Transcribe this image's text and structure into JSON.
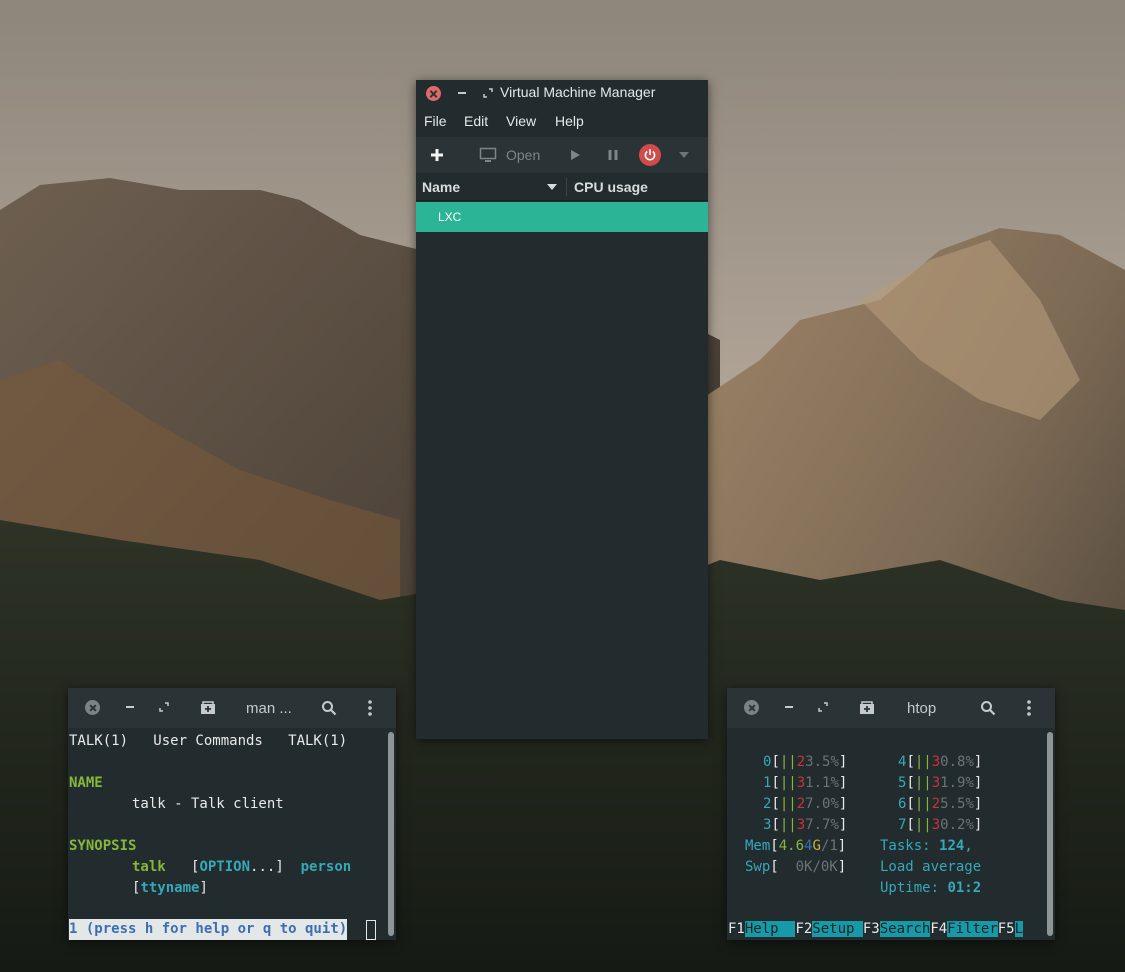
{
  "vmm": {
    "title": "Virtual Machine Manager",
    "menu": [
      "File",
      "Edit",
      "View",
      "Help"
    ],
    "toolbar": {
      "open_label": "Open"
    },
    "columns": {
      "name": "Name",
      "cpu": "CPU usage"
    },
    "rows": [
      {
        "name": "LXC"
      }
    ],
    "colors": {
      "selection": "#2bb496",
      "power": "#d14b4b"
    }
  },
  "man_term": {
    "title": "man ...",
    "lines": {
      "header": "TALK(1)   User Commands   TALK(1)",
      "name_heading": "NAME",
      "name_desc": "talk - Talk client",
      "synopsis_heading": "SYNOPSIS",
      "syn_cmd": "talk",
      "syn_lb": "[",
      "syn_option": "OPTION",
      "syn_rb": "...]",
      "syn_person": "person",
      "syn2_lb": "[",
      "syn2_ttyname": "ttyname",
      "syn2_rb": "]",
      "status": "1 (press h for help or q to quit)"
    }
  },
  "htop_term": {
    "title": "htop",
    "cpus_left": [
      {
        "id": "0",
        "bars": "||",
        "pct_a": "2",
        "pct_b": "3.5%"
      },
      {
        "id": "1",
        "bars": "||",
        "pct_a": "3",
        "pct_b": "1.1%"
      },
      {
        "id": "2",
        "bars": "||",
        "pct_a": "2",
        "pct_b": "7.0%"
      },
      {
        "id": "3",
        "bars": "||",
        "pct_a": "3",
        "pct_b": "7.7%"
      }
    ],
    "cpus_right": [
      {
        "id": "4",
        "bars": "||",
        "pct_a": "3",
        "pct_b": "0.8%"
      },
      {
        "id": "5",
        "bars": "||",
        "pct_a": "3",
        "pct_b": "1.9%"
      },
      {
        "id": "6",
        "bars": "||",
        "pct_a": "2",
        "pct_b": "5.5%"
      },
      {
        "id": "7",
        "bars": "||",
        "pct_a": "3",
        "pct_b": "0.2%"
      }
    ],
    "mem_label": "Mem",
    "mem_a": "4.6",
    "mem_b": "4",
    "mem_c": "G",
    "mem_d": "/1",
    "swp_label": "Swp",
    "swp_value": "0K/0K",
    "tasks_label": "Tasks: ",
    "tasks_value": "124",
    "tasks_tail": ",",
    "load_label": "Load average",
    "uptime_label": "Uptime: ",
    "uptime_value": "01:2",
    "fkeys": [
      {
        "key": "F1",
        "label": "Help  "
      },
      {
        "key": "F2",
        "label": "Setup "
      },
      {
        "key": "F3",
        "label": "Search"
      },
      {
        "key": "F4",
        "label": "Filter"
      },
      {
        "key": "F5",
        "label": "L"
      }
    ]
  }
}
